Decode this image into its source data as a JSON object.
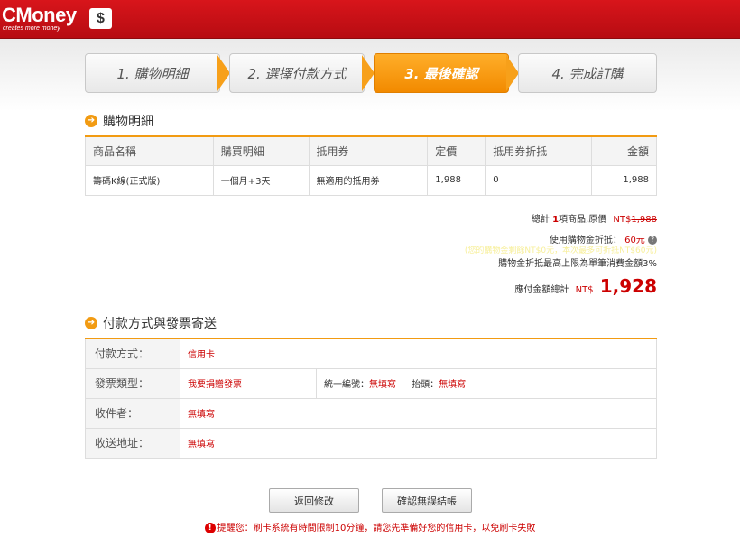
{
  "brand": {
    "name": "CMoney",
    "tagline": "creates more money",
    "badge": "$"
  },
  "steps": [
    {
      "label": "1. 購物明細",
      "active": false
    },
    {
      "label": "2. 選擇付款方式",
      "active": false
    },
    {
      "label": "3. 最後確認",
      "active": true
    },
    {
      "label": "4. 完成訂購",
      "active": false
    }
  ],
  "order_section": {
    "title": "購物明細",
    "columns": [
      "商品名稱",
      "購買明細",
      "抵用券",
      "定價",
      "抵用券折抵",
      "金額"
    ],
    "rows": [
      [
        "籌碼K線(正式版)",
        "一個月+3天",
        "無適用的抵用券",
        "1,988",
        "0",
        "1,988"
      ]
    ]
  },
  "summary": {
    "total_prefix": "總計",
    "count": "1",
    "total_mid": "項商品,原價",
    "orig_currency": "NT$",
    "orig_price": "1,988",
    "discount_label": "使用購物金折抵：",
    "discount_value": "60元",
    "faint_note": "(您的購物金剩餘NT$0元，本次最多可折抵NT$60元)",
    "limit_note": "購物金折抵最高上限為單筆消費金額3%",
    "payable_label": "應付金額總計",
    "payable_currency": "NT$",
    "payable_amount": "1,928"
  },
  "payment_section": {
    "title": "付款方式與發票寄送",
    "method_label": "付款方式：",
    "method_value": "信用卡",
    "invoice_label": "發票類型：",
    "invoice_value": "我要捐贈發票",
    "tax_label": "統一編號：",
    "tax_value": "無填寫",
    "heading_label": "抬頭：",
    "heading_value": "無填寫",
    "recipient_label": "收件者：",
    "recipient_value": "無填寫",
    "address_label": "收送地址：",
    "address_value": "無填寫"
  },
  "buttons": {
    "back": "返回修改",
    "confirm": "確認無誤結帳"
  },
  "notice": "提醒您：刷卡系統有時間限制10分鐘，請您先準備好您的信用卡，以免刷卡失敗",
  "colors": {
    "brand_red": "#c8101a",
    "accent_orange": "#f29b12",
    "price_red": "#cc0000"
  },
  "icons": {
    "section": "arrow-right-circle-icon",
    "help": "question-circle-icon",
    "warning": "exclamation-circle-icon"
  }
}
